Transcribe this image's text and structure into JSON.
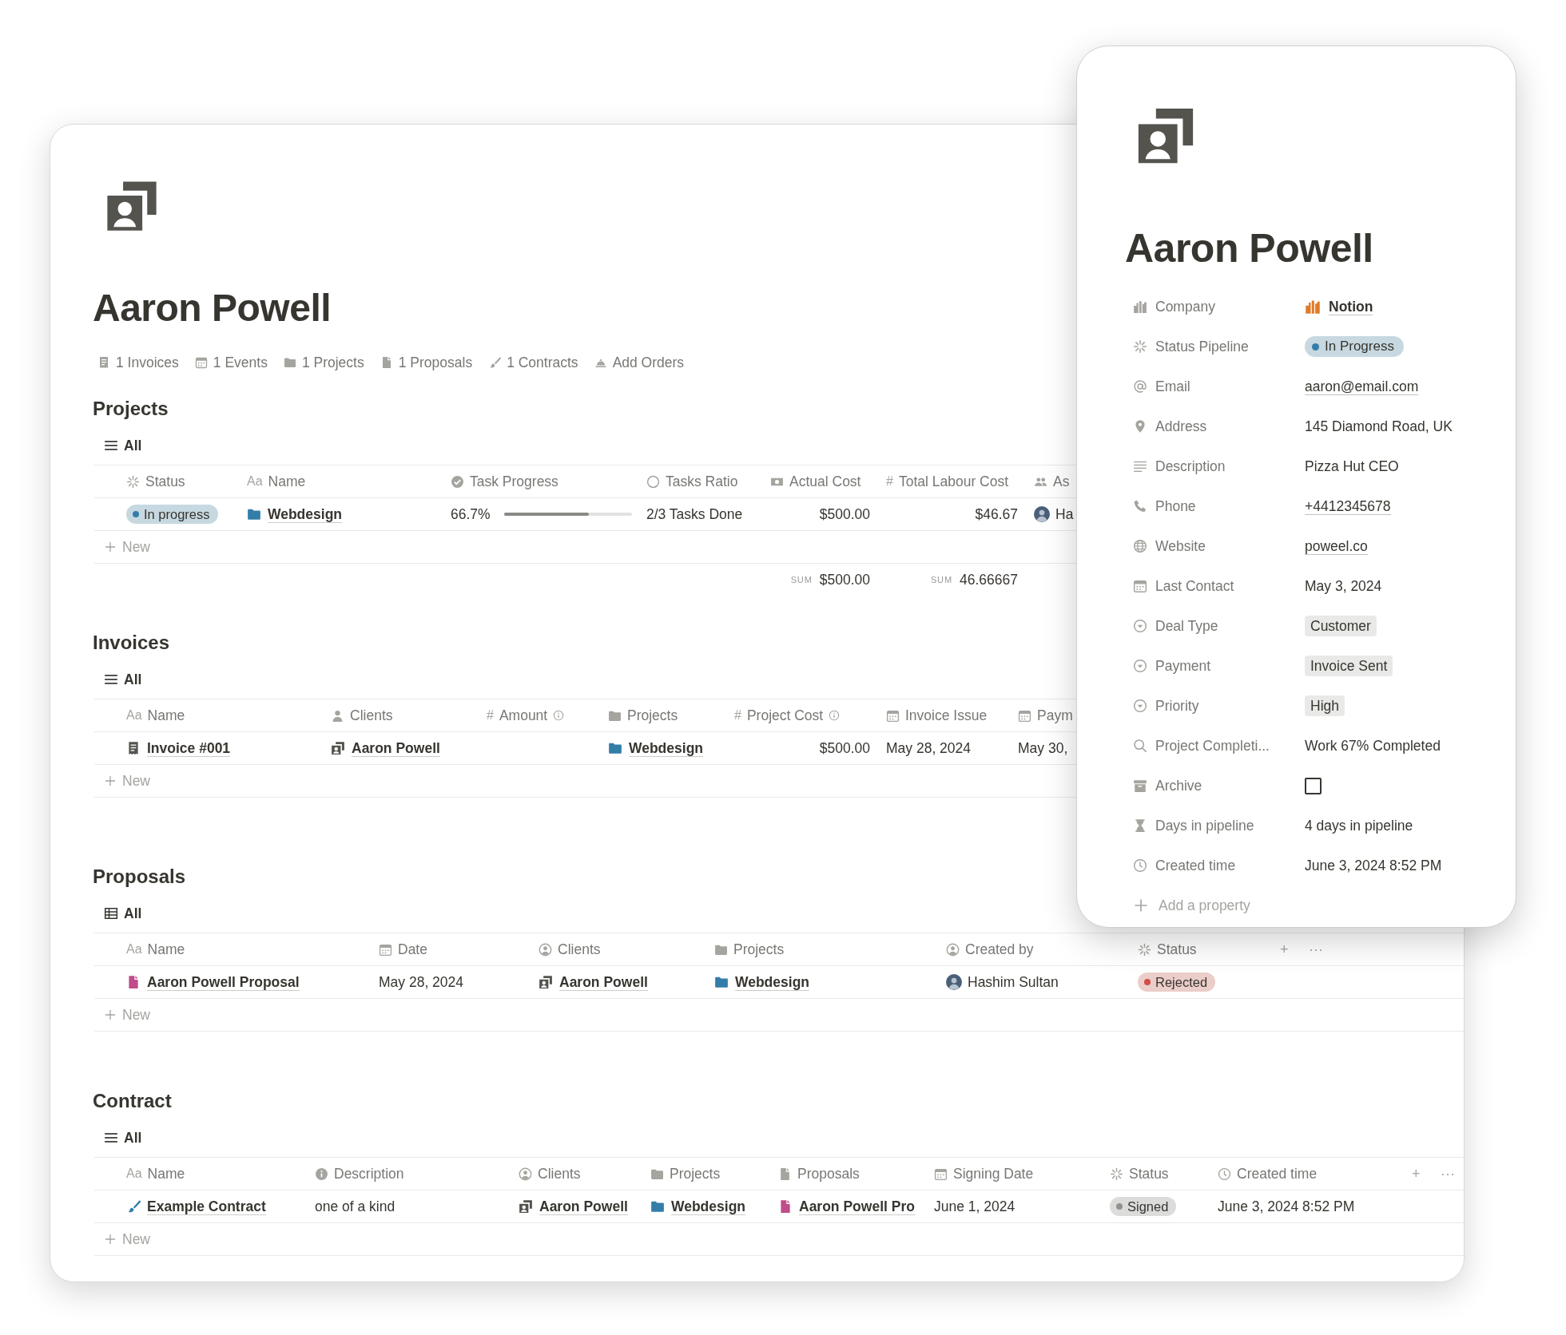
{
  "page": {
    "title": "Aaron Powell",
    "links": [
      {
        "label": "1 Invoices"
      },
      {
        "label": "1 Events"
      },
      {
        "label": "1 Projects"
      },
      {
        "label": "1 Proposals"
      },
      {
        "label": "1 Contracts"
      },
      {
        "label": "Add Orders"
      }
    ]
  },
  "sections": [
    {
      "heading": "Projects",
      "view": {
        "label": "All",
        "kind": "list"
      },
      "new_label": "New",
      "columns": [
        {
          "kind": "status",
          "label": "Status"
        },
        {
          "kind": "title",
          "glyph": "Aa",
          "label": "Name"
        },
        {
          "kind": "progress",
          "label": "Task Progress"
        },
        {
          "kind": "ratio",
          "label": "Tasks Ratio"
        },
        {
          "kind": "currency",
          "label": "Actual Cost",
          "sum": {
            "label": "SUM",
            "value": "$500.00"
          }
        },
        {
          "kind": "number",
          "glyph": "#",
          "label": "Total Labour Cost",
          "sum": {
            "label": "SUM",
            "value": "46.66667"
          }
        },
        {
          "kind": "people",
          "label": "As"
        }
      ],
      "rows": [
        {
          "cells": [
            {
              "kind": "status",
              "text": "In progress",
              "color": "#337ea9"
            },
            {
              "kind": "project",
              "text": "Webdesign"
            },
            {
              "kind": "progress",
              "text": "66.7%",
              "level": 0.667
            },
            {
              "kind": "text",
              "text": "2/3 Tasks Done"
            },
            {
              "kind": "number",
              "text": "$500.00"
            },
            {
              "kind": "number",
              "text": "$46.67"
            },
            {
              "kind": "person",
              "text": "Ha"
            }
          ]
        }
      ]
    },
    {
      "heading": "Invoices",
      "view": {
        "label": "All",
        "kind": "list"
      },
      "new_label": "New",
      "columns": [
        {
          "kind": "title",
          "glyph": "Aa",
          "label": "Name"
        },
        {
          "kind": "person",
          "label": "Clients"
        },
        {
          "kind": "number",
          "glyph": "#",
          "label": "Amount",
          "info": true
        },
        {
          "kind": "project",
          "label": "Projects"
        },
        {
          "kind": "number",
          "glyph": "#",
          "label": "Project Cost",
          "info": true
        },
        {
          "kind": "date",
          "label": "Invoice Issue"
        },
        {
          "kind": "date",
          "label": "Paym"
        }
      ],
      "rows": [
        {
          "cells": [
            {
              "kind": "invoice",
              "text": "Invoice #001"
            },
            {
              "kind": "client",
              "text": "Aaron Powell"
            },
            {
              "kind": "empty"
            },
            {
              "kind": "project",
              "text": "Webdesign"
            },
            {
              "kind": "number",
              "text": "$500.00"
            },
            {
              "kind": "text",
              "text": "May 28, 2024"
            },
            {
              "kind": "text",
              "text": "May 30,"
            }
          ]
        }
      ]
    },
    {
      "heading": "Proposals",
      "view": {
        "label": "All",
        "kind": "table"
      },
      "new_label": "New",
      "header_actions": [
        "+",
        "···"
      ],
      "columns": [
        {
          "kind": "title",
          "glyph": "Aa",
          "label": "Name"
        },
        {
          "kind": "date",
          "label": "Date"
        },
        {
          "kind": "personcircle",
          "label": "Clients"
        },
        {
          "kind": "project",
          "label": "Projects"
        },
        {
          "kind": "personcircle",
          "label": "Created by"
        },
        {
          "kind": "status",
          "label": "Status"
        }
      ],
      "rows": [
        {
          "cells": [
            {
              "kind": "proposal",
              "text": "Aaron Powell Proposal"
            },
            {
              "kind": "text",
              "text": "May 28, 2024"
            },
            {
              "kind": "client",
              "text": "Aaron Powell"
            },
            {
              "kind": "project",
              "text": "Webdesign"
            },
            {
              "kind": "person",
              "text": "Hashim Sultan"
            },
            {
              "kind": "status",
              "text": "Rejected",
              "color": "#d44c47"
            }
          ]
        }
      ]
    },
    {
      "heading": "Contract",
      "view": {
        "label": "All",
        "kind": "list"
      },
      "new_label": "New",
      "header_actions": [
        "+",
        "···"
      ],
      "columns": [
        {
          "kind": "title",
          "glyph": "Aa",
          "label": "Name"
        },
        {
          "kind": "text",
          "label": "Description"
        },
        {
          "kind": "personcircle",
          "label": "Clients"
        },
        {
          "kind": "project",
          "label": "Projects"
        },
        {
          "kind": "proposal",
          "label": "Proposals"
        },
        {
          "kind": "date",
          "label": "Signing Date"
        },
        {
          "kind": "status",
          "label": "Status"
        },
        {
          "kind": "created",
          "label": "Created time"
        }
      ],
      "rows": [
        {
          "cells": [
            {
              "kind": "contract",
              "text": "Example Contract"
            },
            {
              "kind": "text",
              "text": "one of a kind"
            },
            {
              "kind": "client",
              "text": "Aaron Powell"
            },
            {
              "kind": "project",
              "text": "Webdesign"
            },
            {
              "kind": "proposal",
              "text": "Aaron Powell Pro"
            },
            {
              "kind": "text",
              "text": "June 1, 2024"
            },
            {
              "kind": "status",
              "text": "Signed",
              "color": "#91918e"
            },
            {
              "kind": "text",
              "text": "June 3, 2024 8:52 PM"
            }
          ]
        }
      ]
    }
  ],
  "panel": {
    "title": "Aaron Powell",
    "add_label": "Add a property",
    "properties": [
      {
        "label": "Company",
        "kind": "company",
        "value": "Notion"
      },
      {
        "label": "Status Pipeline",
        "kind": "status",
        "value": "In Progress",
        "color": "#337ea9"
      },
      {
        "label": "Email",
        "kind": "link",
        "value": "aaron@email.com"
      },
      {
        "label": "Address",
        "kind": "text",
        "value": "145 Diamond Road, UK"
      },
      {
        "label": "Description",
        "kind": "text",
        "value": "Pizza Hut CEO"
      },
      {
        "label": "Phone",
        "kind": "link",
        "value": "+4412345678"
      },
      {
        "label": "Website",
        "kind": "link",
        "value": "poweel.co"
      },
      {
        "label": "Last Contact",
        "kind": "text",
        "value": "May 3, 2024"
      },
      {
        "label": "Deal Type",
        "kind": "tag",
        "value": "Customer"
      },
      {
        "label": "Payment",
        "kind": "tag",
        "value": "Invoice Sent"
      },
      {
        "label": "Priority",
        "kind": "tag",
        "value": "High"
      },
      {
        "label": "Project Completi...",
        "kind": "text",
        "value": "Work 67% Completed"
      },
      {
        "label": "Archive",
        "kind": "checkbox",
        "checked": false
      },
      {
        "label": "Days in pipeline",
        "kind": "text",
        "value": "4 days in pipeline"
      },
      {
        "label": "Created time",
        "kind": "text",
        "value": "June 3, 2024 8:52 PM"
      }
    ]
  }
}
